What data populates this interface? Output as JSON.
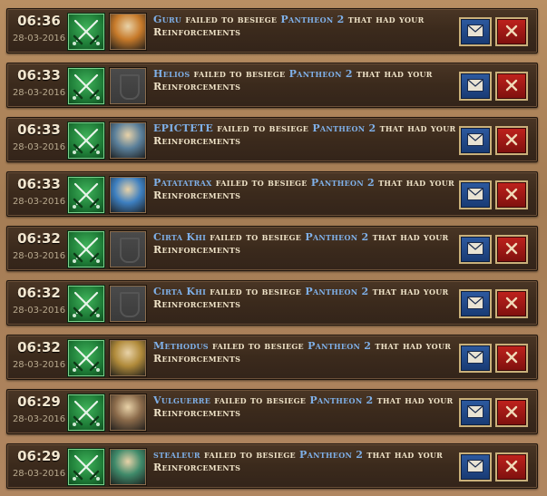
{
  "reports": [
    {
      "time": "06:36",
      "date": "28-03-2016",
      "player": "Guru",
      "action": "failed to besiege",
      "target": "Pantheon 2",
      "suffix": "that had your Reinforcements",
      "avatar": "warrior-portrait",
      "avatar_color": "#c77a2a"
    },
    {
      "time": "06:33",
      "date": "28-03-2016",
      "player": "Helios",
      "action": "failed to besiege",
      "target": "Pantheon 2",
      "suffix": "that had your Reinforcements",
      "avatar": "empty-portrait",
      "avatar_color": "#444444"
    },
    {
      "time": "06:33",
      "date": "28-03-2016",
      "player": "EPICTETE",
      "action": "failed to besiege",
      "target": "Pantheon 2",
      "suffix": "that had your Reinforcements",
      "avatar": "armored-knight-portrait",
      "avatar_color": "#5a7f9a"
    },
    {
      "time": "06:33",
      "date": "28-03-2016",
      "player": "Patatatrax",
      "action": "failed to besiege",
      "target": "Pantheon 2",
      "suffix": "that had your Reinforcements",
      "avatar": "blue-armor-portrait",
      "avatar_color": "#3d7fc0"
    },
    {
      "time": "06:32",
      "date": "28-03-2016",
      "player": "Cirta Khi",
      "action": "failed to besiege",
      "target": "Pantheon 2",
      "suffix": "that had your Reinforcements",
      "avatar": "empty-portrait",
      "avatar_color": "#444444"
    },
    {
      "time": "06:32",
      "date": "28-03-2016",
      "player": "Cirta Khi",
      "action": "failed to besiege",
      "target": "Pantheon 2",
      "suffix": "that had your Reinforcements",
      "avatar": "empty-portrait",
      "avatar_color": "#444444"
    },
    {
      "time": "06:32",
      "date": "28-03-2016",
      "player": "Methodus",
      "action": "failed to besiege",
      "target": "Pantheon 2",
      "suffix": "that had your Reinforcements",
      "avatar": "golden-knight-portrait",
      "avatar_color": "#b08a3a"
    },
    {
      "time": "06:29",
      "date": "28-03-2016",
      "player": "Vulguerre",
      "action": "failed to besiege",
      "target": "Pantheon 2",
      "suffix": "that had your Reinforcements",
      "avatar": "bearded-warrior-portrait",
      "avatar_color": "#8a6a4a"
    },
    {
      "time": "06:29",
      "date": "28-03-2016",
      "player": "stealeur",
      "action": "failed to besiege",
      "target": "Pantheon 2",
      "suffix": "that had your Reinforcements",
      "avatar": "helmeted-soldier-portrait",
      "avatar_color": "#3f8a6a"
    }
  ],
  "icons": {
    "battle": "crossed-swords-icon",
    "mail": "envelope-icon",
    "delete": "close-icon"
  },
  "colors": {
    "player_link": "#7fb0e8",
    "text": "#efe3c8",
    "mail_button": "#244a8a",
    "delete_button": "#a41a16"
  }
}
